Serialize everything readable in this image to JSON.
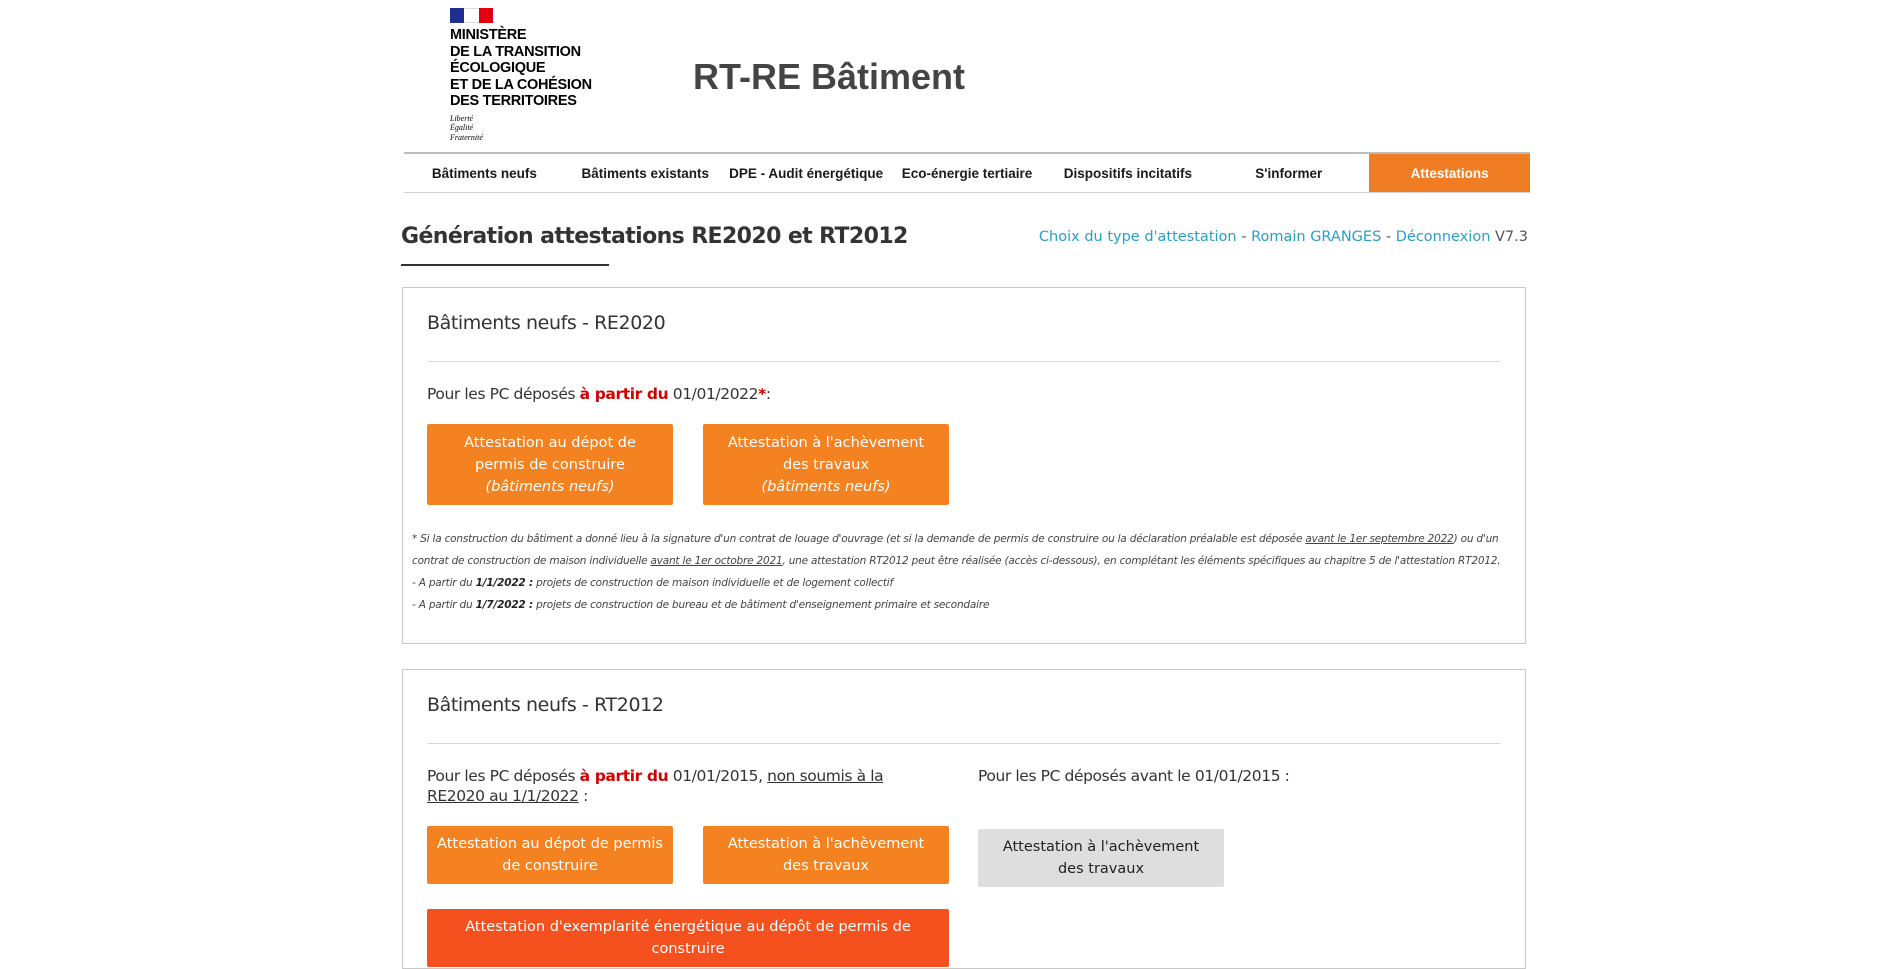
{
  "header": {
    "ministry_lines": [
      "MINISTÈRE",
      "DE LA TRANSITION",
      "ÉCOLOGIQUE",
      "ET DE LA COHÉSION",
      "DES TERRITOIRES"
    ],
    "motto_lines": [
      "Liberté",
      "Égalité",
      "Fraternité"
    ],
    "site_title": "RT-RE Bâtiment"
  },
  "nav": {
    "items": [
      {
        "label": "Bâtiments neufs"
      },
      {
        "label": "Bâtiments existants"
      },
      {
        "label": "DPE - Audit énergétique"
      },
      {
        "label": "Eco-énergie tertiaire"
      },
      {
        "label": "Dispositifs incitatifs"
      },
      {
        "label": "S'informer"
      },
      {
        "label": "Attestations"
      }
    ],
    "active_index": 6
  },
  "page": {
    "title": "Génération attestations RE2020 et RT2012",
    "links": {
      "choose_type": "Choix du type d'attestation",
      "sep1": " - ",
      "user": "Romain GRANGES",
      "sep2": " - ",
      "logout": "Déconnexion",
      "version": " V7.3"
    }
  },
  "re2020": {
    "heading": "Bâtiments neufs - RE2020",
    "intro_prefix": "Pour les PC déposés ",
    "intro_red": "à partir du",
    "intro_date": " 01/01/2022",
    "intro_star": "*",
    "intro_suffix": ":",
    "btn_depot_line1": "Attestation au dépot de",
    "btn_depot_line2": "permis de construire",
    "btn_depot_line3": "(bâtiments neufs)",
    "btn_achev_line1": "Attestation à l'achèvement",
    "btn_achev_line2": "des travaux",
    "btn_achev_line3": "(bâtiments neufs)",
    "note1_a": "* Si la construction du bâtiment a donné lieu à la signature d'un contrat de louage d'ouvrage (et si la demande de permis de construire ou la déclaration préalable est déposée ",
    "note1_u1": "avant le 1er septembre 2022",
    "note1_b": ") ou d'un contrat de construction de maison individuelle ",
    "note1_u2": "avant le 1er octobre 2021",
    "note1_c": ", une attestation RT2012 peut être réalisée (accès ci-dessous), en complétant les éléments spécifiques au chapitre 5 de l'attestation RT2012.",
    "note2_a": "- A partir du ",
    "note2_b": "1/1/2022 :",
    "note2_c": " projets de construction de maison individuelle et de logement collectif",
    "note3_a": "- A partir du ",
    "note3_b": "1/7/2022 :",
    "note3_c": " projets de construction de bureau et de bâtiment d'enseignement primaire et secondaire"
  },
  "rt2012": {
    "heading": "Bâtiments neufs - RT2012",
    "left_prefix": "Pour les PC déposés ",
    "left_red": "à partir du",
    "left_date": " 01/01/2015, ",
    "left_ul": "non soumis à la RE2020 au 1/1/2022",
    "left_suffix": " :",
    "right_intro": "Pour les PC déposés avant le 01/01/2015 :",
    "btn_depot": "Attestation au dépot de permis de construire",
    "btn_achev": "Attestation à l'achèvement des travaux",
    "btn_achev_old": "Attestation à l'achèvement des travaux",
    "btn_exemplarite": "Attestation d'exemplarité énergétique au dépôt de permis de construire"
  },
  "colors": {
    "accent_orange": "#f58220",
    "nav_active": "#f07d24",
    "exemplarite": "#f4511e",
    "link_blue": "#2a9fc4",
    "emphasis_red": "#d40000"
  }
}
